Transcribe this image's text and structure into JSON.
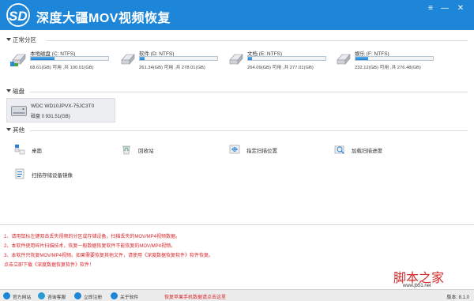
{
  "window": {
    "title": "深度大疆MOV视频恢复",
    "buttons": {
      "menu": "≡",
      "minimize": "—",
      "close": "✕"
    }
  },
  "sections": {
    "partitions": "正常分区",
    "disks": "磁盘",
    "other": "其他"
  },
  "drives": [
    {
      "name": "本地磁盘 (C: NTFS)",
      "stat": "68.61(GB) 可用 ,共 100.01(GB)",
      "used_fraction": 0.31
    },
    {
      "name": "软件 (D: NTFS)",
      "stat": "261.34(GB) 可用 ,共 278.01(GB)",
      "used_fraction": 0.06
    },
    {
      "name": "文档 (E: NTFS)",
      "stat": "264.09(GB) 可用 ,共 277.01(GB)",
      "used_fraction": 0.05
    },
    {
      "name": "娱乐 (F: NTFS)",
      "stat": "232.12(GB) 可用 ,共 276.48(GB)",
      "used_fraction": 0.16
    }
  ],
  "disk": {
    "model": "WDC WD10JPVX-75JC3T0",
    "info": "磁盘 0    931.51(GB)"
  },
  "tools": [
    {
      "label": "桌面",
      "icon": "desktop-icon"
    },
    {
      "label": "回收站",
      "icon": "recycle-bin-icon"
    },
    {
      "label": "指定扫描位置",
      "icon": "scan-location-icon"
    },
    {
      "label": "加载扫描进度",
      "icon": "load-progress-icon"
    },
    {
      "label": "扫描存储设备镜像",
      "icon": "disk-image-icon"
    }
  ],
  "notes": [
    "1、请用鼠标左键双击丢失视频的分区或存储设备，扫描丢失的MOV/MP4视频数据。",
    "2、本软件使用碎片扫描技术，恢复一般数据恢复软件不能恢复的MOV/MP4视频。",
    "3、本软件只恢复MOV/MP4视频。如果需要恢复其他文件，请使用《深度数据恢复软件》软件恢复。",
    "    点击立即下载《深度数据恢复软件》软件！"
  ],
  "statusbar": {
    "items": [
      {
        "label": "官方网站",
        "icon": "home-icon",
        "color": "#1e86d8"
      },
      {
        "label": "咨询客服",
        "icon": "chat-icon",
        "color": "#2b9bd6"
      },
      {
        "label": "立即注册",
        "icon": "register-icon",
        "color": "#1e86d8"
      },
      {
        "label": "关于软件",
        "icon": "info-icon",
        "color": "#1e86d8"
      }
    ],
    "link": "恢复苹果手机数据请点击这里",
    "version": "版本: 8.1.0"
  },
  "watermark": {
    "title": "脚本之家",
    "url": "www.jb51.net"
  },
  "colors": {
    "titlebar": "#1e86d8",
    "progress": "#1f7fd0",
    "notes": "#d8262b"
  }
}
